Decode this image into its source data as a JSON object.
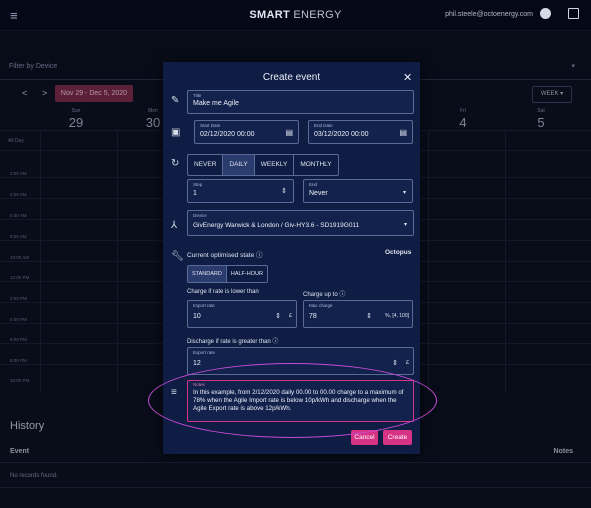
{
  "topbar": {
    "menu_icon": "hamburger-icon",
    "brand_bold": "SMART",
    "brand_rest": " ENERGY",
    "email": "phil.steele@octoenergy.com"
  },
  "filter": {
    "label": "Filter by Device"
  },
  "calendar": {
    "nav_prev": "<",
    "nav_next": ">",
    "date_range": "Nov 29 - Dec 5, 2020",
    "view": "WEEK ▾",
    "days": [
      {
        "name": "Sun",
        "num": "29"
      },
      {
        "name": "Mon",
        "num": "30"
      },
      {
        "name": "Fri",
        "num": "4"
      },
      {
        "name": "Sat",
        "num": "5"
      }
    ],
    "all_day": "All Day",
    "times": [
      "2:00 AM",
      "4:00 AM",
      "6:00 AM",
      "8:00 AM",
      "10:00 AM",
      "12:00 PM",
      "2:00 PM",
      "4:00 PM",
      "6:00 PM",
      "8:00 PM",
      "10:00 PM"
    ]
  },
  "history": {
    "title": "History",
    "col_event": "Event",
    "col_notes": "Notes",
    "empty": "No records found."
  },
  "dialog": {
    "title": "Create event",
    "close": "✕",
    "title_field": {
      "label": "Title",
      "value": "Make me Agile"
    },
    "start_date": {
      "label": "Start Date",
      "value": "02/12/2020 00:00"
    },
    "end_date": {
      "label": "End Date",
      "value": "03/12/2020 00:00"
    },
    "repeat_options": [
      "NEVER",
      "DAILY",
      "WEEKLY",
      "MONTHLY"
    ],
    "repeat_selected": "DAILY",
    "step": {
      "label": "Step",
      "value": "1"
    },
    "end": {
      "label": "End",
      "value": "Never"
    },
    "device": {
      "label": "Device",
      "value": "GivEnergy Warwick & London / Giv-HY3.6 - SD1919G011"
    },
    "optimised_label": "Current optimised state ⓘ",
    "provider": "Octopus",
    "rate_options": [
      "STANDARD",
      "HALF-HOUR"
    ],
    "rate_selected": "STANDARD",
    "charge_if_label": "Charge if rate is lower than",
    "charge_up_label": "Charge up to ⓘ",
    "import_rate": {
      "label": "Import rate",
      "value": "10",
      "unit": "£"
    },
    "max_charge": {
      "label": "Max charge",
      "value": "78",
      "unit": "%, [4, 100]"
    },
    "discharge_label": "Discharge if rate is greater than ⓘ",
    "export_rate": {
      "label": "Export rate",
      "value": "12",
      "unit": "£"
    },
    "notes": {
      "label": "Notes",
      "value": "In this example, from 2/12/2020 daily 00.00 to 00.00 charge to a maximum of 78% when the Agile Import rate is below 10p/kWh and discharge when the Agile Export rate is above 12p/kWh."
    },
    "cancel": "Cancel",
    "create": "Create"
  },
  "colors": {
    "accent": "#d63384",
    "dialog_bg": "#0f1d44",
    "highlight": "#c64bd6"
  }
}
